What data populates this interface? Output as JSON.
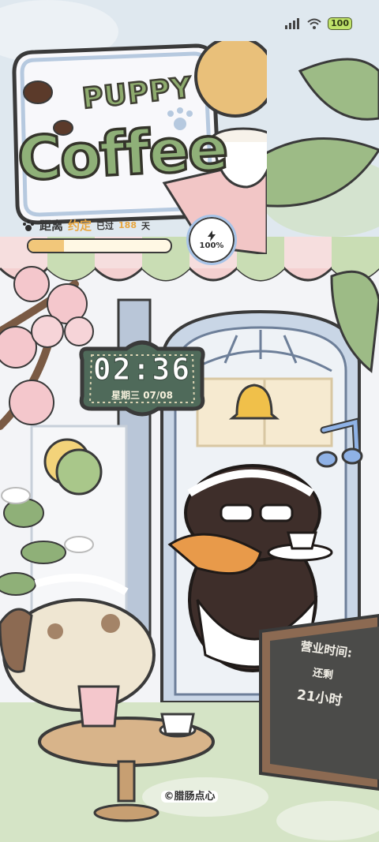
{
  "status_bar": {
    "battery_level": "100",
    "icons": [
      "signal-icon",
      "wifi-icon",
      "battery-icon"
    ]
  },
  "title": {
    "line1": "PUPPY",
    "line2": "Coffee"
  },
  "countdown": {
    "prefix": "距离",
    "highlight": "约定",
    "middle": "已过",
    "number": "188",
    "suffix": "天",
    "progress_fraction": 0.25
  },
  "battery_widget": {
    "percent": "100%",
    "icon": "lightning-icon"
  },
  "clock": {
    "time": "02:36",
    "date": "星期三 07/08"
  },
  "chalkboard": {
    "title": "营业时间:",
    "remaining": "还剩",
    "hours": "21小时"
  },
  "credit": "©腊肠点心",
  "colors": {
    "accent_green": "#8fb078",
    "sign_green": "#4f6a5a",
    "tablecloth_pink": "#f2c6c6",
    "awning_pink": "#f6d8d8",
    "awning_green": "#c5dcb0",
    "battery_ring": "#a8c4e8",
    "chalkboard": "#4b4b49"
  }
}
